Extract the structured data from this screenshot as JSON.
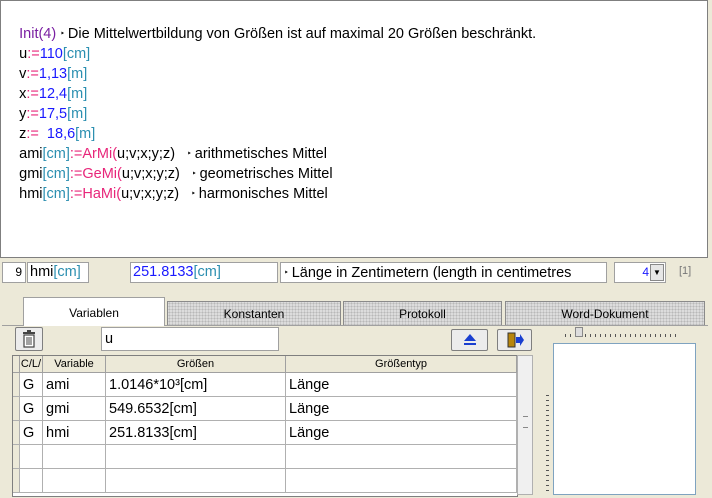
{
  "editor": {
    "lines": [
      {
        "a": "Init(4)",
        "b": "Die Mittelwertbildung von Größen ist auf maximal 20 Größen beschränkt."
      },
      {
        "a": "u:=110",
        "b": "[cm]"
      },
      {
        "a": "v:=1,13",
        "b": "[m]"
      },
      {
        "a": "x:=12,4",
        "b": "[m]"
      },
      {
        "a": "y:=17,5",
        "b": "[m]"
      },
      {
        "a": "z:= 18,6",
        "b": "[m]"
      },
      {
        "n": "ami",
        "u": "[cm]",
        "op": ":=",
        "f": "ArMi(",
        "args": "u;v;x;y;z)",
        "c": "arithmetisches Mittel"
      },
      {
        "n": "gmi",
        "u": "[cm]",
        "op": ":=",
        "f": "GeMi(",
        "args": "u;v;x;y;z)",
        "c": "geometrisches Mittel"
      },
      {
        "n": "hmi",
        "u": "[cm]",
        "op": ":=",
        "f": "HaMi(",
        "args": "u;v;x;y;z)",
        "c": "harmonisches Mittel"
      }
    ],
    "triangle": "‣"
  },
  "status": {
    "line_no": "9",
    "name": "hmi",
    "unit": "[cm]",
    "value": "251.8133",
    "value_unit": "[cm]",
    "comment": "Länge in Zentimetern (length in centimetres",
    "precision": "4",
    "index": "[1]"
  },
  "tabs": [
    "Variablen",
    "Konstanten",
    "Protokoll",
    "Word-Dokument"
  ],
  "toolbar": {
    "search_value": "u",
    "delete_icon": "trash-icon",
    "eject_icon": "eject-icon",
    "exit_icon": "exit-icon"
  },
  "table": {
    "headers": [
      "C/L/",
      "Variable",
      "Größen",
      "Größentyp"
    ],
    "rows": [
      [
        "G",
        "ami",
        "1.0146*10³[cm]",
        "Länge"
      ],
      [
        "G",
        "gmi",
        "549.6532[cm]",
        "Länge"
      ],
      [
        "G",
        "hmi",
        "251.8133[cm]",
        "Länge"
      ],
      [
        "",
        "",
        "",
        ""
      ],
      [
        "",
        "",
        "",
        ""
      ]
    ]
  },
  "colors": {
    "keyword": "#7a1fa2",
    "number": "#1a1aff",
    "unit": "#2b8fb0",
    "function": "#e8267a",
    "operator": "#e8267a"
  }
}
